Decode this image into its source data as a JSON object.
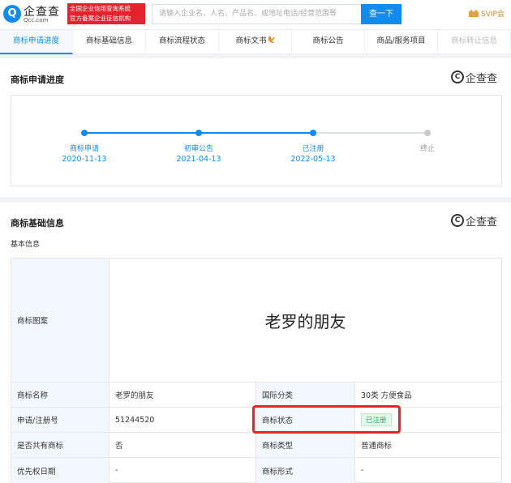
{
  "header": {
    "logo_glyph": "Q",
    "logo_name": "企查查",
    "logo_domain": "Qcc.com",
    "badge_lines": [
      "全国企业信用查询系统",
      "官方备案企业征信机构"
    ],
    "search_placeholder": "请输入企业名、人名、产品名、或地址电话/经营范围等",
    "search_button": "查一下",
    "svip_label": "SVIP会"
  },
  "tabs": [
    {
      "label": "商标申请进度",
      "active": true
    },
    {
      "label": "商标基础信息"
    },
    {
      "label": "商标流程状态"
    },
    {
      "label": "商标文书",
      "flag": true
    },
    {
      "label": "商标公告"
    },
    {
      "label": "商品/服务项目"
    },
    {
      "label": "商标转让信息",
      "faded": true
    }
  ],
  "progress": {
    "title": "商标申请进度",
    "watermark": "企查查",
    "steps": [
      {
        "label": "商标申请",
        "date": "2020-11-13",
        "done": true
      },
      {
        "label": "初审公告",
        "date": "2021-04-13",
        "done": true
      },
      {
        "label": "已注册",
        "date": "2022-05-13",
        "done": true
      },
      {
        "label": "终止",
        "date": "",
        "done": false
      }
    ]
  },
  "basic": {
    "title": "商标基础信息",
    "watermark": "企查查",
    "subtitle": "基本信息",
    "image_label": "商标图案",
    "image_text": "老罗的朋友",
    "rows": [
      {
        "l1": "商标名称",
        "v1": "老罗的朋友",
        "l2": "国际分类",
        "v2": "30类 方便食品"
      },
      {
        "l1": "申请/注册号",
        "v1": "51244520",
        "l2": "商标状态",
        "v2": "已注册"
      },
      {
        "l1": "是否共有商标",
        "v1": "否",
        "l2": "商标类型",
        "v2": "普通商标"
      },
      {
        "l1": "优先权日期",
        "v1": "-",
        "l2": "商标形式",
        "v2": "-"
      }
    ]
  },
  "colors": {
    "accent": "#128bed",
    "status_green": "#2eaf5b",
    "highlight_red": "#e8232b"
  }
}
